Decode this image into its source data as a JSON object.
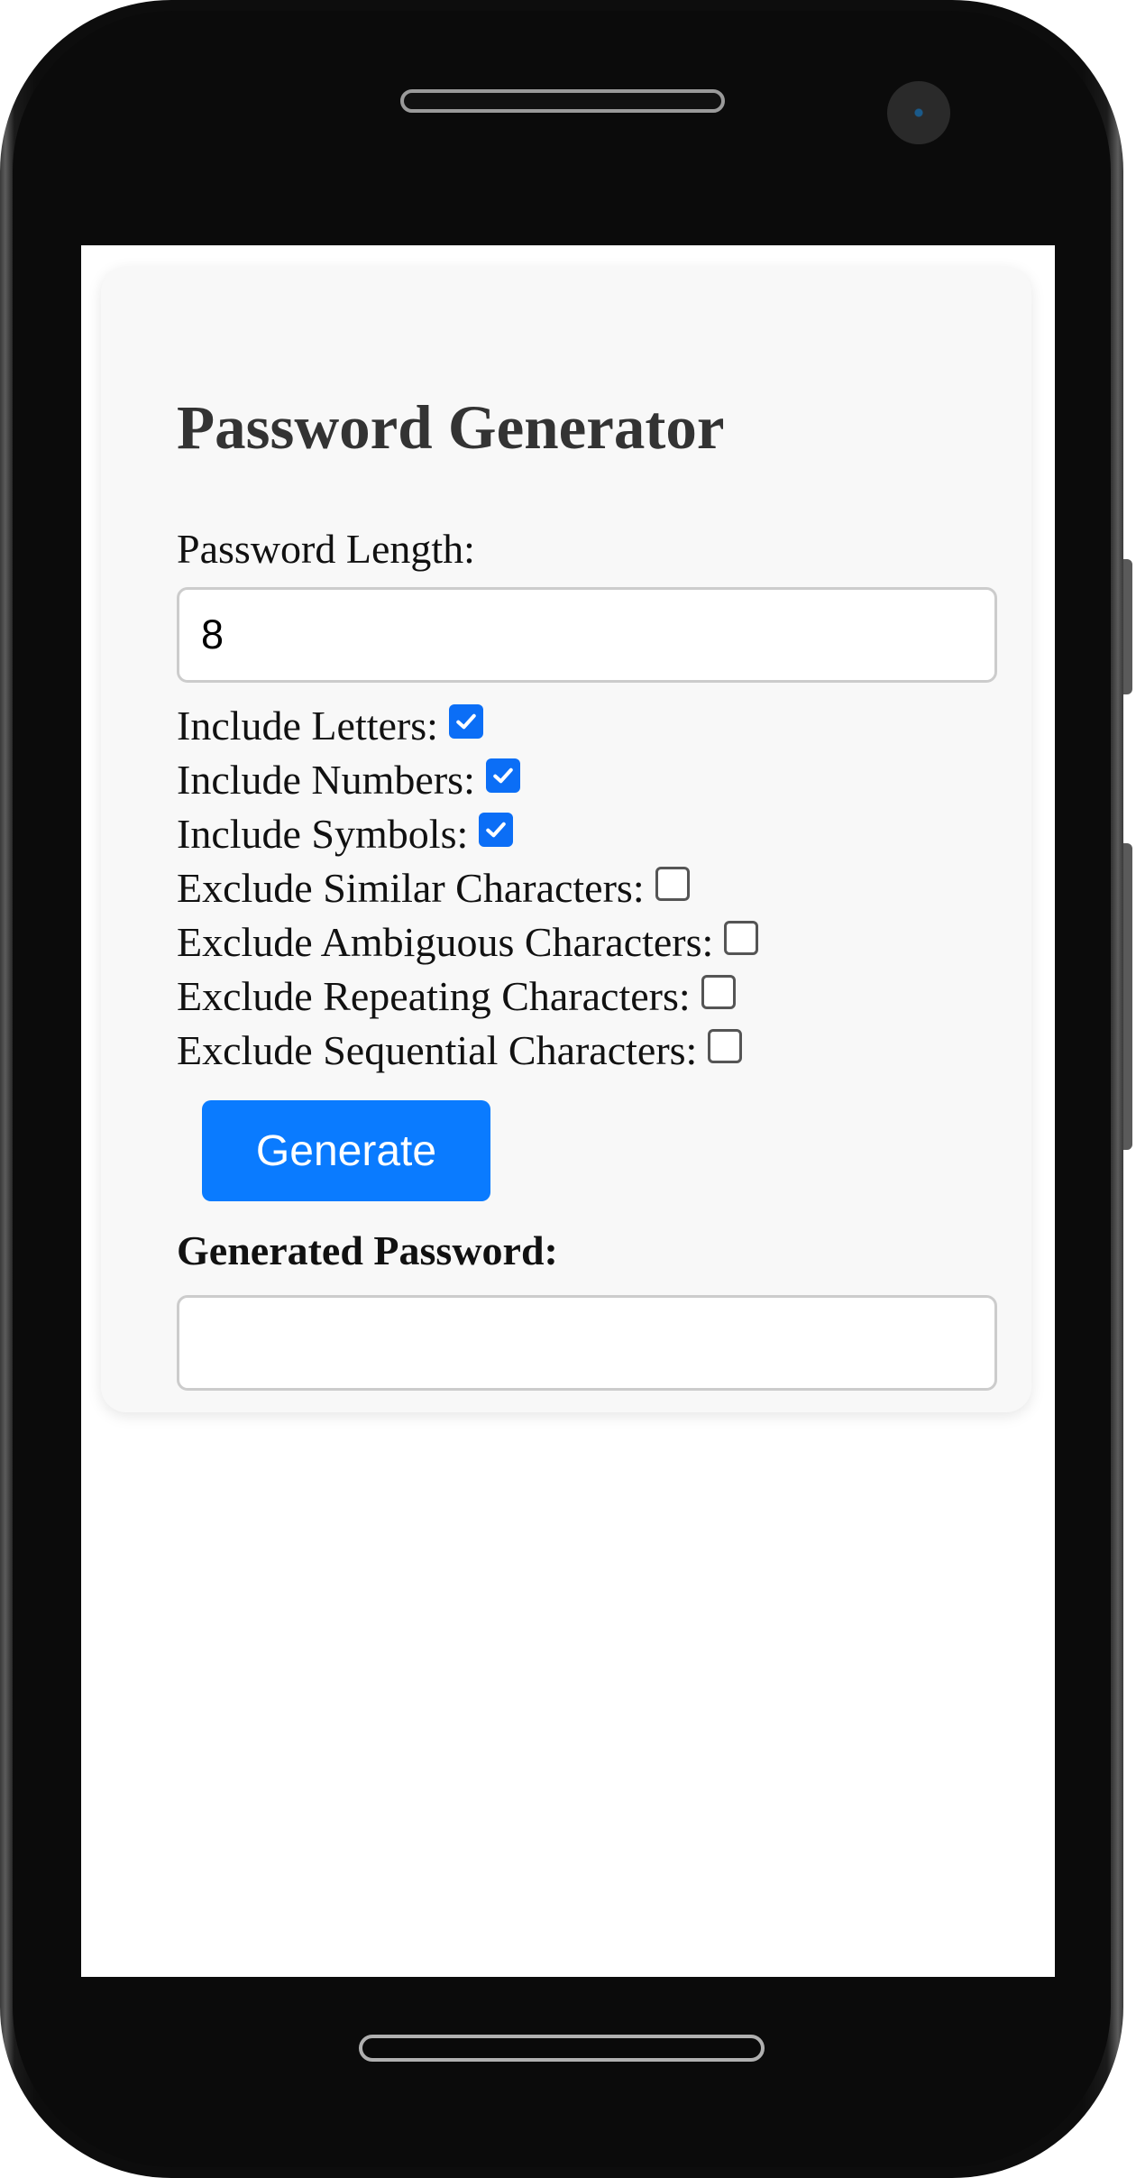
{
  "app": {
    "title": "Password Generator"
  },
  "length": {
    "label": "Password Length:",
    "value": "8"
  },
  "options": [
    {
      "label": "Include Letters:",
      "checked": true
    },
    {
      "label": "Include Numbers:",
      "checked": true
    },
    {
      "label": "Include Symbols:",
      "checked": true
    },
    {
      "label": "Exclude Similar Characters:",
      "checked": false
    },
    {
      "label": "Exclude Ambiguous Characters:",
      "checked": false
    },
    {
      "label": "Exclude Repeating Characters:",
      "checked": false
    },
    {
      "label": "Exclude Sequential Characters:",
      "checked": false
    }
  ],
  "generate": {
    "label": "Generate"
  },
  "output": {
    "label": "Generated Password:",
    "value": ""
  },
  "colors": {
    "accent": "#0a7bff",
    "checkbox_checked": "#0b6ef6",
    "card_background": "#f8f8f8",
    "title_text": "#333333"
  },
  "icons": {
    "checkmark": "check-icon"
  }
}
